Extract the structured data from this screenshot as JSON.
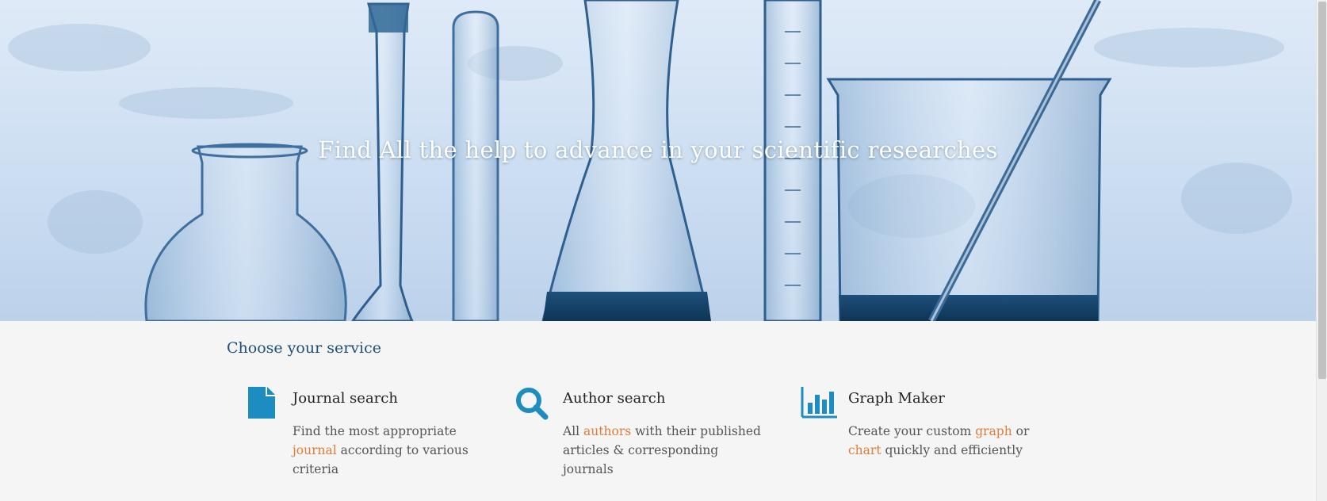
{
  "hero": {
    "title": "Find All the help to advance in your scientific researches"
  },
  "services": {
    "heading": "Choose your service",
    "items": [
      {
        "name": "Journal search",
        "icon": "document-icon",
        "desc_before": "Find the most appropriate ",
        "desc_highlight_1": "journal",
        "desc_middle": "  according to various criteria",
        "desc_highlight_2": "",
        "desc_after": ""
      },
      {
        "name": "Author search",
        "icon": "search-icon",
        "desc_before": "All ",
        "desc_highlight_1": "authors",
        "desc_middle": "  with their published articles & corresponding journals",
        "desc_highlight_2": "",
        "desc_after": ""
      },
      {
        "name": "Graph Maker",
        "icon": "bar-chart-icon",
        "desc_before": "Create your custom ",
        "desc_highlight_1": "graph",
        "desc_middle": "  or ",
        "desc_highlight_2": "chart",
        "desc_after": " quickly and efficiently"
      }
    ]
  },
  "colors": {
    "accent_blue": "#1d8cc0",
    "heading_blue": "#1d4f78",
    "highlight_orange": "#e07b39"
  }
}
